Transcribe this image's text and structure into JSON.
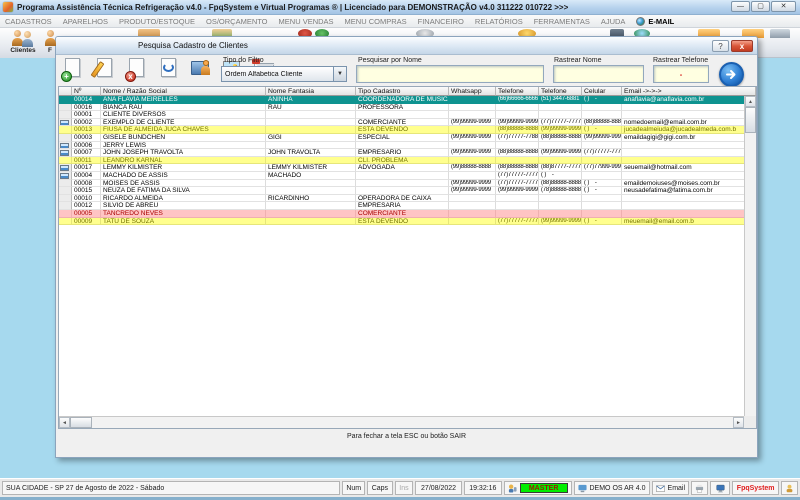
{
  "window": {
    "title": "Programa Assistência Técnica Refrigeração v4.0 - FpqSystem e Virtual Programas ® | Licenciado para  DEMONSTRAÇÃO v4.0 311222 010722 >>>",
    "minimize": "—",
    "maximize": "▢",
    "close": "✕"
  },
  "menu": {
    "items": [
      "CADASTROS",
      "APARELHOS",
      "PRODUTO/ESTOQUE",
      "OS/ORÇAMENTO",
      "MENU VENDAS",
      "MENU COMPRAS",
      "FINANCEIRO",
      "RELATÓRIOS",
      "FERRAMENTAS",
      "AJUDA",
      "E-MAIL"
    ]
  },
  "toolbar": {
    "clientes_label": "Clientes",
    "second_label": "F"
  },
  "dialog": {
    "title": "Pesquisa Cadastro de Clientes",
    "help": "?",
    "close": "x",
    "filter_label": "Tipo do Filtro",
    "filter_value": "Ordem Alfabetica Cliente",
    "search_name_label": "Pesquisar por Nome",
    "search_name_value": "",
    "track_name_label": "Rastrear Nome",
    "track_name_value": "",
    "track_phone_label": "Rastrear Telefone",
    "track_phone_value": "-",
    "footer": "Para fechar a tela ESC ou botão SAIR",
    "table": {
      "columns": [
        "Nº",
        "Nome / Razão Social",
        "Nome Fantasia",
        "Tipo Cadastro",
        "Whatsapp",
        "Telefone",
        "Telefone",
        "Celular",
        "Email ->->->"
      ],
      "rows": [
        {
          "num": "00014",
          "nome": "ANA FLAVIA MEIRELLES",
          "fantasia": "ANINHA",
          "tipo": "COORDENADORA DE MUSICA",
          "whatsapp": "",
          "tel1": "(66)66666-6666",
          "tel2": "(51) 3447-6881",
          "celular": "( )    -",
          "email": "anaflavia@anaflavia.com.br",
          "state": "selected",
          "icon": false
        },
        {
          "num": "00016",
          "nome": "BIANCA RAU",
          "fantasia": "RAU",
          "tipo": "PROFESSORA",
          "whatsapp": "",
          "tel1": "",
          "tel2": "",
          "celular": "",
          "email": "",
          "state": "normal",
          "icon": false
        },
        {
          "num": "00001",
          "nome": "CLIENTE DIVERSOS",
          "fantasia": "",
          "tipo": "",
          "whatsapp": "",
          "tel1": "",
          "tel2": "",
          "celular": "",
          "email": "",
          "state": "normal",
          "icon": false
        },
        {
          "num": "00002",
          "nome": "EXEMPLO DE CLIENTE",
          "fantasia": "",
          "tipo": "COMERCIANTE",
          "whatsapp": "(99)99999-9999",
          "tel1": "(99)99999-9999",
          "tel2": "(77)77777-7777",
          "celular": "(88)88888-8888",
          "email": "nomedoemail@email.com.br",
          "state": "normal",
          "icon": true
        },
        {
          "num": "00013",
          "nome": "FIUSA DE ALMEIDA JUCA CHAVES",
          "fantasia": "",
          "tipo": "ESTA DEVENDO",
          "whatsapp": "",
          "tel1": "(88)88888-8888",
          "tel2": "(99)99999-9999",
          "celular": "( )    -",
          "email": "jucadealmeiuda@jucadealmeda.com.b",
          "state": "yellow",
          "icon": false
        },
        {
          "num": "00003",
          "nome": "GISELE BUNDCHEN",
          "fantasia": "GIGI",
          "tipo": "ESPECIAL",
          "whatsapp": "(99)99999-9999",
          "tel1": "(77)77777-7788",
          "tel2": "(88)88888-8888",
          "celular": "(99)99999-9999",
          "email": "emaildagigi@gigi.com.br",
          "state": "normal",
          "icon": false
        },
        {
          "num": "00006",
          "nome": "JERRY LEWIS",
          "fantasia": "",
          "tipo": "",
          "whatsapp": "",
          "tel1": "",
          "tel2": "",
          "celular": "",
          "email": "",
          "state": "normal",
          "icon": true
        },
        {
          "num": "00007",
          "nome": "JOHN JOSEPH TRAVOLTA",
          "fantasia": "JOHN TRAVOLTA",
          "tipo": "EMPRESARIO",
          "whatsapp": "(99)99999-9999",
          "tel1": "(88)88888-8888",
          "tel2": "(99)99999-9999",
          "celular": "(77)77777-7777",
          "email": "",
          "state": "normal",
          "icon": true
        },
        {
          "num": "00011",
          "nome": "LEANDRO KARNAL",
          "fantasia": "",
          "tipo": "CLI. PROBLEMA",
          "whatsapp": "",
          "tel1": "",
          "tel2": "",
          "celular": "",
          "email": "",
          "state": "yellow",
          "icon": false
        },
        {
          "num": "00017",
          "nome": "LEMMY KILMISTER",
          "fantasia": "LEMMY KILMISTER",
          "tipo": "ADVOGADA",
          "whatsapp": "(99)88888-8888",
          "tel1": "(88)88888-8888",
          "tel2": "(88)87777-7777",
          "celular": "(77)77999-9999",
          "email": "seuemail@hotmail.com",
          "state": "normal",
          "icon": true
        },
        {
          "num": "00004",
          "nome": "MACHADO DE ASSIS",
          "fantasia": "MACHADO",
          "tipo": "",
          "whatsapp": "",
          "tel1": "(77)77777-7777",
          "tel2": "( )    -",
          "celular": "",
          "email": "",
          "state": "normal",
          "icon": true
        },
        {
          "num": "00008",
          "nome": "MOISES DE ASSIS",
          "fantasia": "",
          "tipo": "",
          "whatsapp": "(99)99999-9999",
          "tel1": "(77)77777-7777",
          "tel2": "(88)88888-8888",
          "celular": "( )    -",
          "email": "emaildemoiuses@moises.com.br",
          "state": "normal",
          "icon": false
        },
        {
          "num": "00015",
          "nome": "NEUZA DE FATIMA DA SILVA",
          "fantasia": "",
          "tipo": "",
          "whatsapp": "(99)99999-9999",
          "tel1": "(99)99999-9999",
          "tel2": "(78)88888-8888",
          "celular": "( )    -",
          "email": "neusadefatima@fatima.com.br",
          "state": "normal",
          "icon": false
        },
        {
          "num": "00010",
          "nome": "RICARDO ALMEIDA",
          "fantasia": "RICARDINHO",
          "tipo": "OPERADORA DE CAIXA",
          "whatsapp": "",
          "tel1": "",
          "tel2": "",
          "celular": "",
          "email": "",
          "state": "normal",
          "icon": false
        },
        {
          "num": "00012",
          "nome": "SILVIO DE ABREU",
          "fantasia": "",
          "tipo": "EMPRESARIA",
          "whatsapp": "",
          "tel1": "",
          "tel2": "",
          "celular": "",
          "email": "",
          "state": "normal",
          "icon": false
        },
        {
          "num": "00005",
          "nome": "TANCREDO NEVES",
          "fantasia": "",
          "tipo": "COMERCIANTE",
          "whatsapp": "",
          "tel1": "",
          "tel2": "",
          "celular": "",
          "email": "",
          "state": "pink",
          "icon": false
        },
        {
          "num": "00009",
          "nome": "TATU DE SOUZA",
          "fantasia": "",
          "tipo": "ESTA DEVENDO",
          "whatsapp": "",
          "tel1": "(77)77777-7777",
          "tel2": "(99)99999-9999",
          "celular": "( )    -",
          "email": "meuemail@email.com.b",
          "state": "yellow",
          "icon": false
        }
      ]
    }
  },
  "statusbar": {
    "location": "SUA CIDADE - SP 27 de Agosto de 2022 - Sábado",
    "num": "Num",
    "caps": "Caps",
    "ins": "Ins",
    "date": "27/08/2022",
    "time": "19:32:16",
    "master": "MASTER",
    "demo": "DEMO OS AR 4.0",
    "email": "Email",
    "brand": "FpqSystem"
  },
  "colors": {
    "accent_teal": "#0e9390",
    "row_yellow": "#ffff8e",
    "row_pink": "#ffc4c4",
    "input_yellow": "#ffffe1",
    "master_green": "#00ee00",
    "brand_red": "#e02020"
  }
}
